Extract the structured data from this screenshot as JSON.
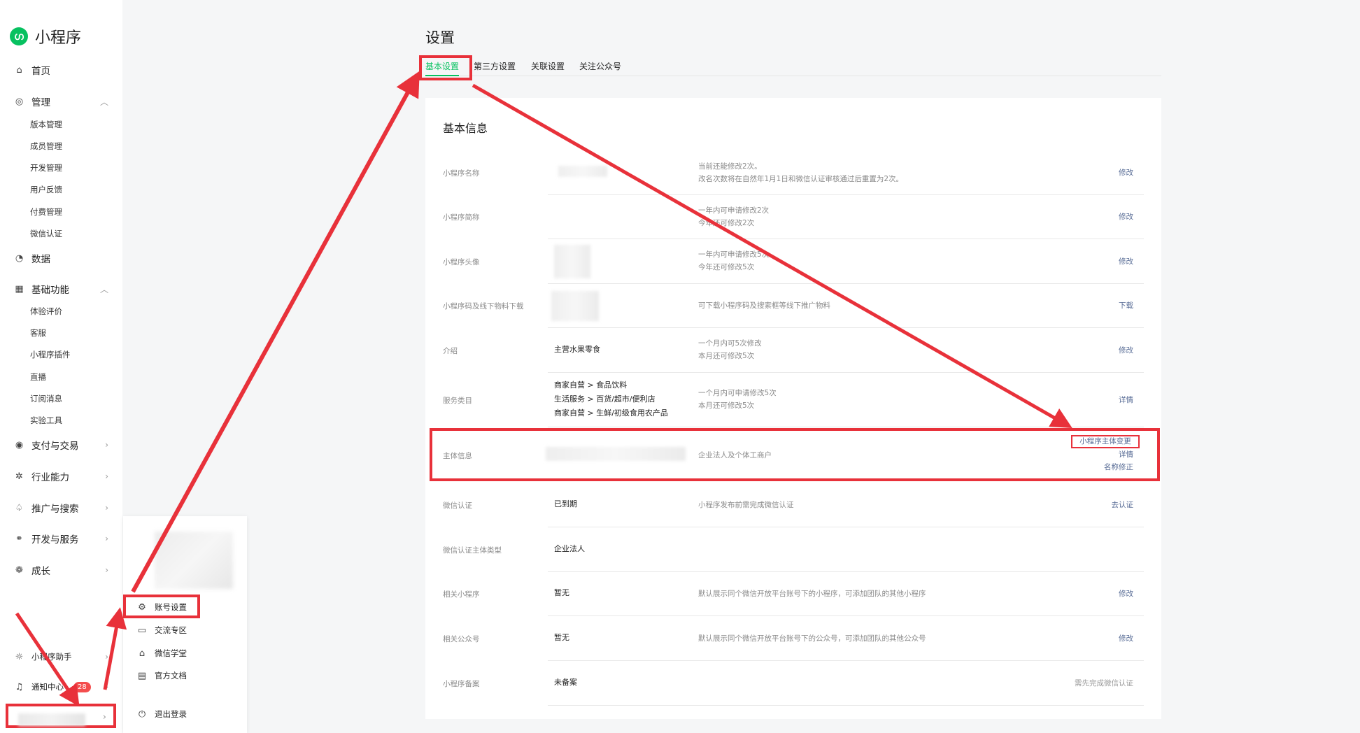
{
  "app": {
    "name": "小程序",
    "logo_icon": "mini-program-logo-icon",
    "accent": "#07c160",
    "link_color": "#576b95",
    "highlight_color": "#e8313a"
  },
  "sidebar": {
    "home": "首页",
    "manage": "管理",
    "manage_items": [
      "版本管理",
      "成员管理",
      "开发管理",
      "用户反馈",
      "付费管理",
      "微信认证"
    ],
    "data": "数据",
    "basic": "基础功能",
    "basic_items": [
      "体验评价",
      "客服",
      "小程序插件",
      "直播",
      "订阅消息",
      "实验工具"
    ],
    "pay": "支付与交易",
    "industry": "行业能力",
    "promote": "推广与搜索",
    "dev": "开发与服务",
    "growth": "成长",
    "assistant": "小程序助手",
    "notify": "通知中心",
    "notify_badge": "28"
  },
  "popup": {
    "items": [
      "账号设置",
      "交流专区",
      "微信学堂",
      "官方文档"
    ],
    "logout": "退出登录"
  },
  "page": {
    "title": "设置",
    "tabs": [
      "基本设置",
      "第三方设置",
      "关联设置",
      "关注公众号"
    ]
  },
  "card": {
    "title": "基本信息",
    "rows": {
      "name": {
        "label": "小程序名称",
        "desc1": "当前还能修改2次。",
        "desc2": "改名次数将在自然年1月1日和微信认证审核通过后重置为2次。",
        "action": "修改"
      },
      "short": {
        "label": "小程序简称",
        "desc1": "一年内可申请修改2次",
        "desc2": "今年还可修改2次",
        "action": "修改"
      },
      "avatar": {
        "label": "小程序头像",
        "desc1": "一年内可申请修改5次",
        "desc2": "今年还可修改5次",
        "action": "修改"
      },
      "code": {
        "label": "小程序码及线下物料下载",
        "desc1": "可下载小程序码及搜索框等线下推广物料",
        "action": "下载"
      },
      "intro": {
        "label": "介绍",
        "value": "主营水果零食",
        "desc1": "一个月内可5次修改",
        "desc2": "本月还可修改5次",
        "action": "修改"
      },
      "category": {
        "label": "服务类目",
        "values": [
          "商家自营 > 食品饮料",
          "生活服务 > 百货/超市/便利店",
          "商家自营 > 生鲜/初级食用农产品"
        ],
        "desc1": "一个月内可申请修改5次",
        "desc2": "本月还可修改5次",
        "action": "详情"
      },
      "subject": {
        "label": "主体信息",
        "desc1": "企业法人及个体工商户",
        "action_change": "小程序主体变更",
        "action_detail": "详情",
        "action_fix": "名称修正"
      },
      "cert": {
        "label": "微信认证",
        "value": "已到期",
        "desc1": "小程序发布前需完成微信认证",
        "action": "去认证"
      },
      "cert_type": {
        "label": "微信认证主体类型",
        "value": "企业法人"
      },
      "related_mp": {
        "label": "相关小程序",
        "value": "暂无",
        "desc1": "默认展示同个微信开放平台账号下的小程序，可添加团队的其他小程序",
        "action": "修改"
      },
      "related_oa": {
        "label": "相关公众号",
        "value": "暂无",
        "desc1": "默认展示同个微信开放平台账号下的公众号，可添加团队的其他公众号",
        "action": "修改"
      },
      "filing": {
        "label": "小程序备案",
        "value": "未备案",
        "action": "需先完成微信认证"
      }
    }
  }
}
